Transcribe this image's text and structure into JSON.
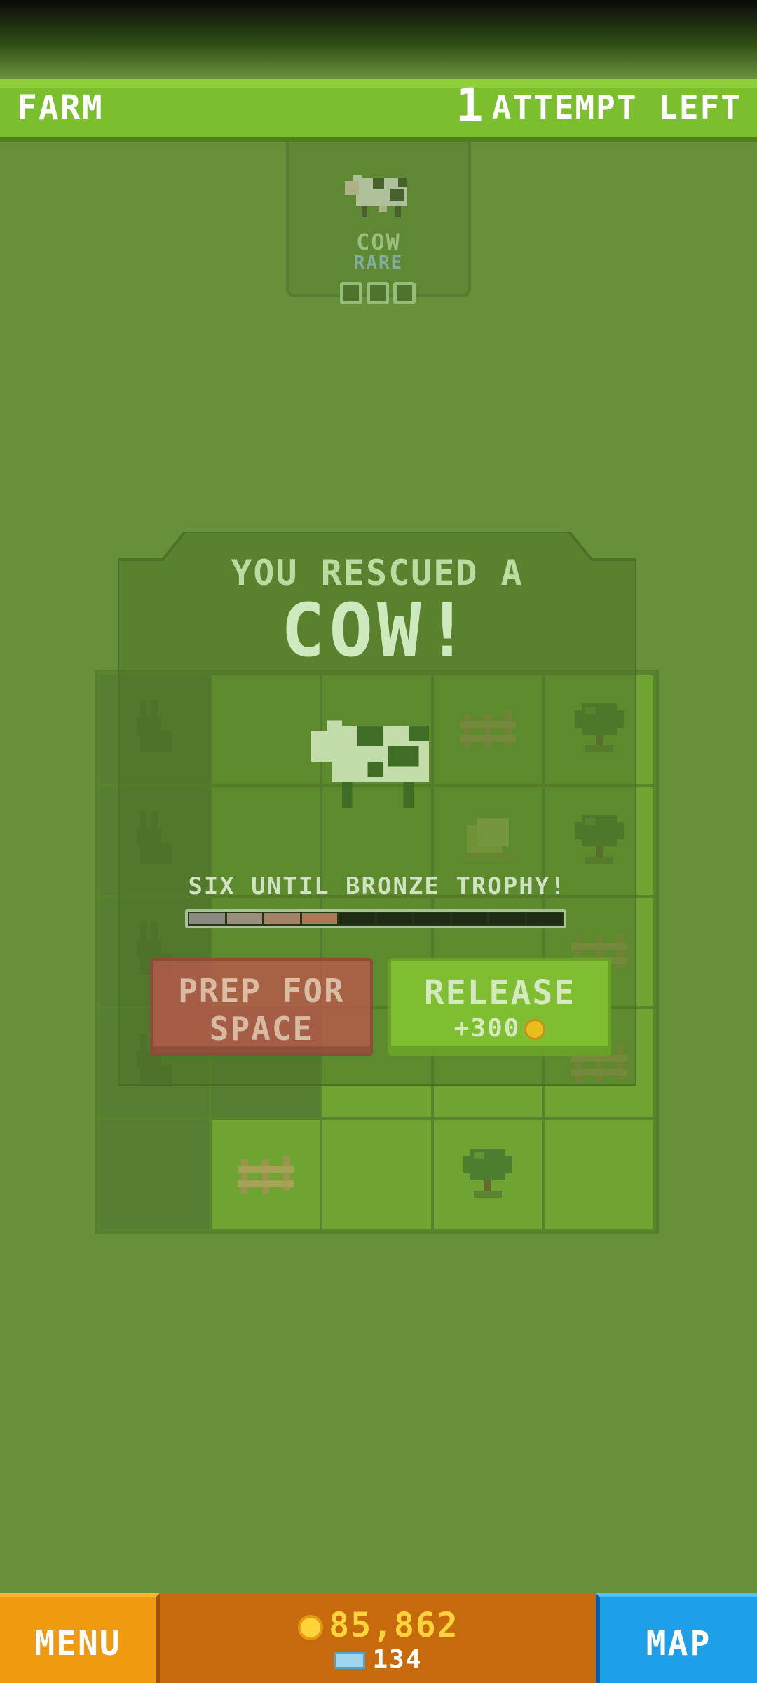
{
  "header": {
    "level_title": "FARM",
    "attempts_count": "1",
    "attempts_label": "ATTEMPT LEFT"
  },
  "animal_card": {
    "name": "COW",
    "rarity": "RARE",
    "trophy_slots": 3
  },
  "reward": {
    "line1": "YOU RESCUED A",
    "line2": "COW!",
    "trophy_text": "SIX UNTIL BRONZE TROPHY!",
    "progress": {
      "filled": 4,
      "total": 10
    },
    "prep_label_1": "PREP FOR",
    "prep_label_2": "SPACE",
    "release_label": "RELEASE",
    "release_reward": "+300"
  },
  "farm_grid": {
    "rows": [
      [
        "rabbit",
        "grass",
        "grass",
        "fence",
        "tree"
      ],
      [
        "rabbit",
        "grass",
        "grass",
        "hay",
        "tree"
      ],
      [
        "rabbit",
        "grass",
        "grass",
        "grass",
        "fence"
      ],
      [
        "rabbit",
        "empty",
        "grass",
        "grass",
        "fence"
      ],
      [
        "empty",
        "fence",
        "grass",
        "tree",
        "grass"
      ]
    ]
  },
  "bottom_bar": {
    "menu_label": "MENU",
    "coins": "85,862",
    "tickets": "134",
    "map_label": "MAP"
  },
  "colors": {
    "grass": "#77b42f",
    "header": "#7cbf2e",
    "menu": "#f09a10",
    "map": "#1ea0e8",
    "coin": "#ffd43a"
  }
}
